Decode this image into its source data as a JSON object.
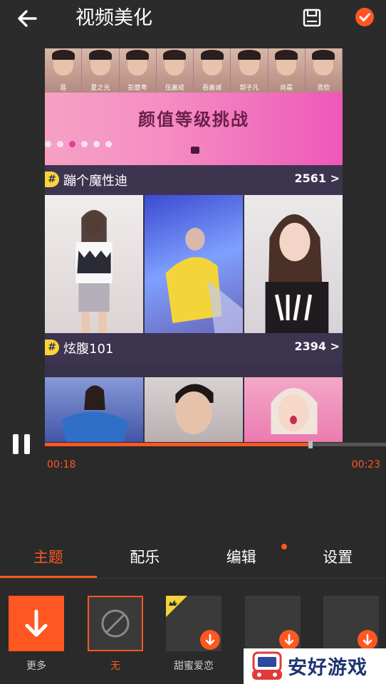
{
  "header": {
    "title": "视频美化",
    "back_icon": "arrow-left-icon",
    "save_icon": "save-icon",
    "confirm_icon": "check-icon"
  },
  "video": {
    "faces": [
      "逛",
      "夏之光",
      "彭楚粤",
      "伍嘉成",
      "吞嘉诚",
      "郭子凡",
      "尚晨",
      "焉钦"
    ],
    "banner_title": "颜值等级挑战",
    "sections": [
      {
        "name": "蹦个魔性迪",
        "count": "2561 >"
      },
      {
        "name": "炫腹101",
        "count": "2394 >"
      }
    ]
  },
  "player": {
    "current_time": "00:18",
    "total_time": "00:23",
    "progress": 0.82,
    "pause_icon": "pause-icon"
  },
  "tabs": [
    "主题",
    "配乐",
    "编辑",
    "设置"
  ],
  "active_tab": 0,
  "themes": [
    {
      "label": "更多",
      "icon": "download-arrow-icon"
    },
    {
      "label": "无",
      "icon": "none-circle-icon"
    },
    {
      "label": "甜蜜爱恋",
      "icon": "download-icon"
    },
    {
      "label": "",
      "icon": "download-icon"
    },
    {
      "label": "",
      "icon": "download-icon"
    }
  ],
  "watermark": {
    "text": "安好游戏"
  },
  "colors": {
    "accent": "#ff5722",
    "background": "#2a2a2a"
  }
}
